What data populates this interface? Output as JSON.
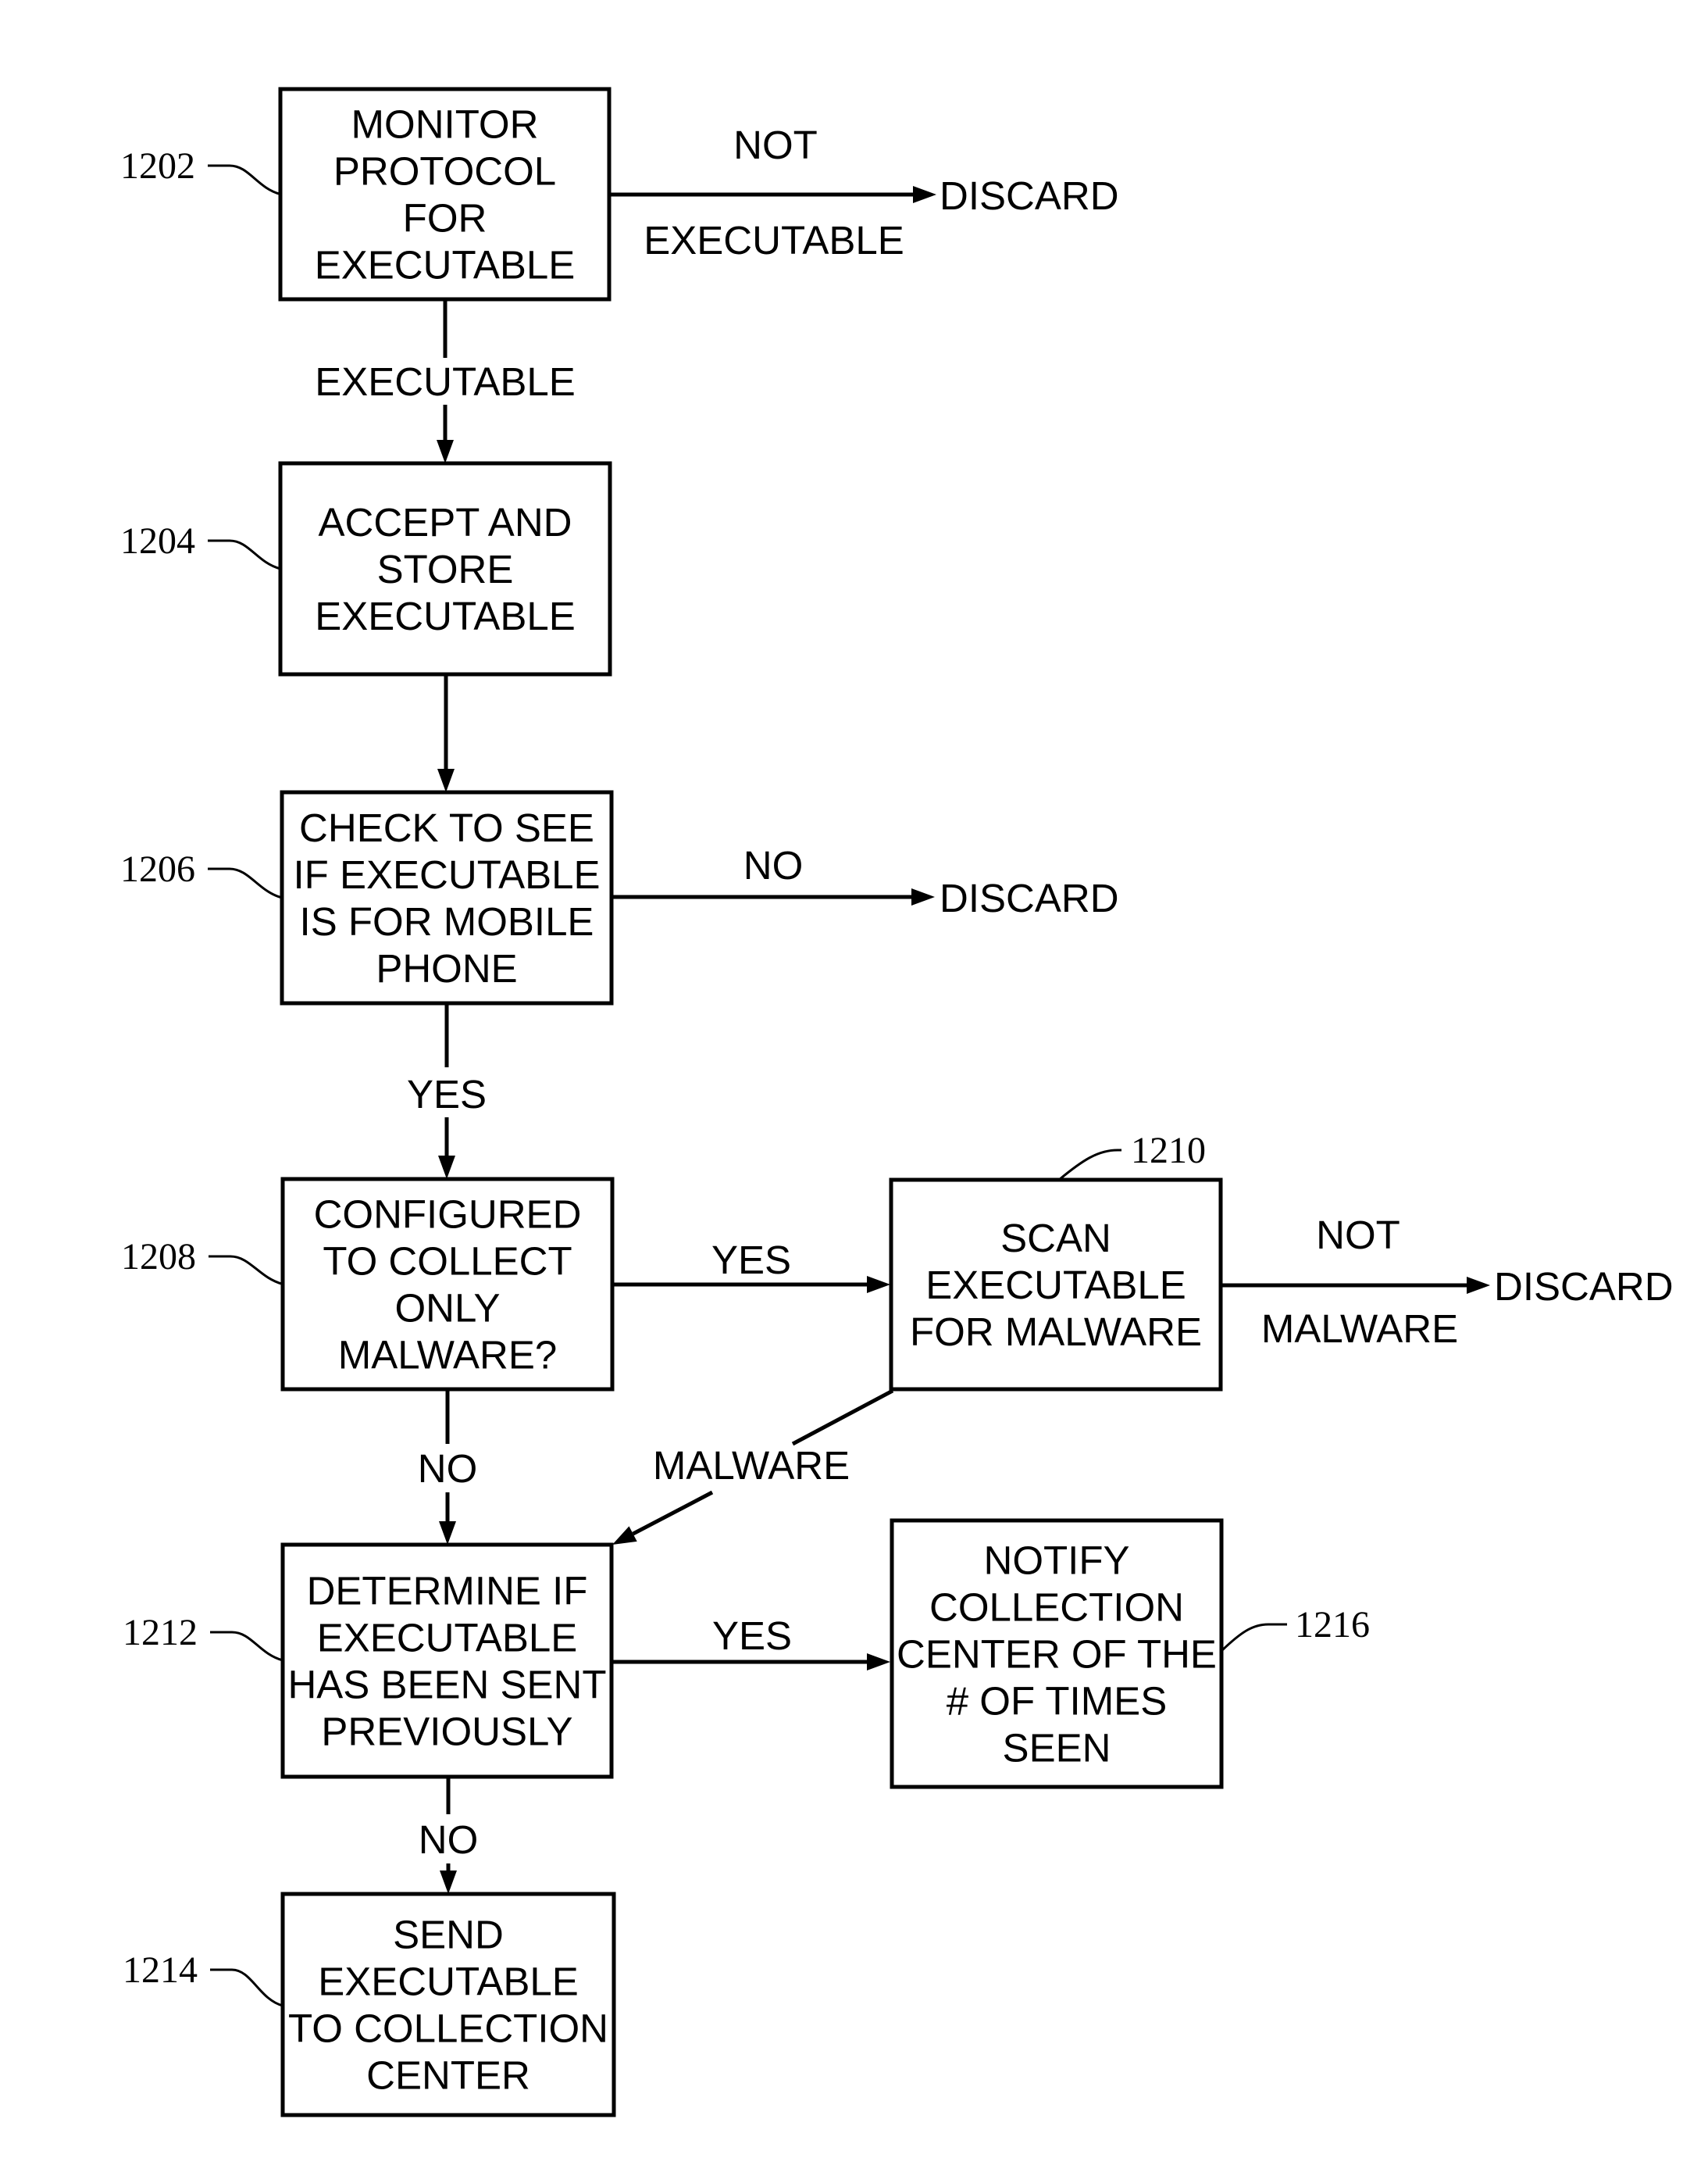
{
  "figure": {
    "nodes": [
      {
        "id": "1202",
        "ref": "1202",
        "lines": [
          "MONITOR",
          "PROTOCOL",
          "FOR",
          "EXECUTABLE"
        ]
      },
      {
        "id": "1204",
        "ref": "1204",
        "lines": [
          "ACCEPT AND",
          "STORE",
          "EXECUTABLE"
        ]
      },
      {
        "id": "1206",
        "ref": "1206",
        "lines": [
          "CHECK TO SEE",
          "IF EXECUTABLE",
          "IS FOR MOBILE",
          "PHONE"
        ]
      },
      {
        "id": "1208",
        "ref": "1208",
        "lines": [
          "CONFIGURED",
          "TO COLLECT",
          "ONLY",
          "MALWARE?"
        ]
      },
      {
        "id": "1210",
        "ref": "1210",
        "lines": [
          "SCAN",
          "EXECUTABLE",
          "FOR MALWARE"
        ]
      },
      {
        "id": "1212",
        "ref": "1212",
        "lines": [
          "DETERMINE IF",
          "EXECUTABLE",
          "HAS BEEN SENT",
          "PREVIOUSLY"
        ]
      },
      {
        "id": "1214",
        "ref": "1214",
        "lines": [
          "SEND",
          "EXECUTABLE",
          "TO COLLECTION",
          "CENTER"
        ]
      },
      {
        "id": "1216",
        "ref": "1216",
        "lines": [
          "NOTIFY",
          "COLLECTION",
          "CENTER OF THE",
          "# OF TIMES",
          "SEEN"
        ]
      }
    ],
    "terminals": {
      "discard_1": "DISCARD",
      "discard_2": "DISCARD",
      "discard_3": "DISCARD"
    },
    "edges": [
      {
        "id": "e1202-discard",
        "from": "1202",
        "to": "discard_1",
        "label_lines": [
          "NOT",
          "EXECUTABLE"
        ]
      },
      {
        "id": "e1202-1204",
        "from": "1202",
        "to": "1204",
        "label_lines": [
          "EXECUTABLE"
        ]
      },
      {
        "id": "e1204-1206",
        "from": "1204",
        "to": "1206",
        "label_lines": []
      },
      {
        "id": "e1206-discard",
        "from": "1206",
        "to": "discard_2",
        "label_lines": [
          "NO"
        ]
      },
      {
        "id": "e1206-1208",
        "from": "1206",
        "to": "1208",
        "label_lines": [
          "YES"
        ]
      },
      {
        "id": "e1208-1210",
        "from": "1208",
        "to": "1210",
        "label_lines": [
          "YES"
        ]
      },
      {
        "id": "e1210-discard",
        "from": "1210",
        "to": "discard_3",
        "label_lines": [
          "NOT",
          "MALWARE"
        ]
      },
      {
        "id": "e1210-1212",
        "from": "1210",
        "to": "1212",
        "label_lines": [
          "MALWARE"
        ]
      },
      {
        "id": "e1208-1212",
        "from": "1208",
        "to": "1212",
        "label_lines": [
          "NO"
        ]
      },
      {
        "id": "e1212-1216",
        "from": "1212",
        "to": "1216",
        "label_lines": [
          "YES"
        ]
      },
      {
        "id": "e1212-1214",
        "from": "1212",
        "to": "1214",
        "label_lines": [
          "NO"
        ]
      }
    ]
  }
}
